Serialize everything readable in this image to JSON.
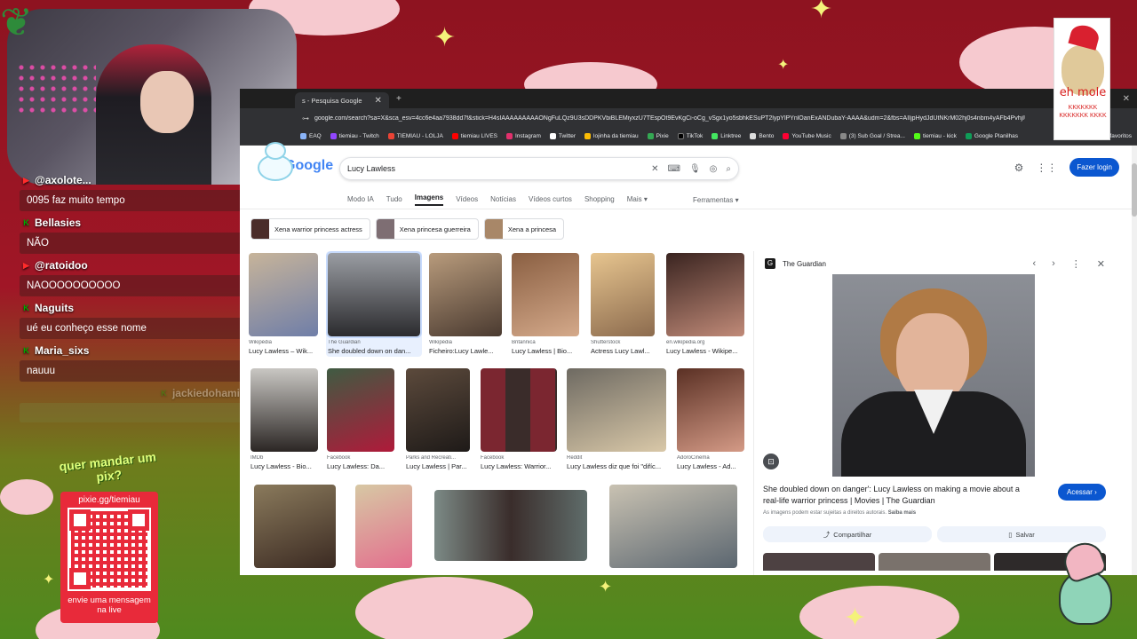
{
  "colors": {
    "bg_red": "#8e1320",
    "bg_green": "#4f8a1e",
    "accent_blue": "#0b57d0"
  },
  "stream": {
    "chat": [
      {
        "user": "@axolote...",
        "platform": "youtube",
        "message": "0095 faz muito tempo"
      },
      {
        "user": "Bellasies",
        "platform": "kick",
        "message": "NÃO"
      },
      {
        "user": "@ratoidoo",
        "platform": "youtube",
        "message": "NAOOOOOOOOOO"
      },
      {
        "user": "Naguits",
        "platform": "kick",
        "message": "ué eu conheço esse nome"
      },
      {
        "user": "Maria_sixs",
        "platform": "kick",
        "message": "nauuu"
      },
      {
        "user": "jackiedohamilton",
        "platform": "kick",
        "message": ""
      }
    ],
    "pix": {
      "title": "quer mandar um pix?",
      "url": "pixie.gg/tiemiau",
      "note": "envie uma mensagem na live"
    },
    "sticker": {
      "text1": "eh mole",
      "text2": "KKKKKKK KKKKKKK KKKK"
    }
  },
  "browser": {
    "tab_title": "s - Pesquisa Google",
    "url": "google.com/search?sa=X&sca_esv=4cc6e4aa7938dd7f&stick=H4sIAAAAAAAAAONgFuLQz9U3sDDPKVbiBLEMiyxzU7TEspOt9EvKgCi-oCg_vSgx1yo5sbhkESuPT2lypYlPYnlOanExANDubaY-AAAA&udm=2&fbs=AIIjpHydJdUtNKrM02hj0s4nbm4yAFb4PvhjIU",
    "bookmarks": [
      "EAQ",
      "tiemiau - Twitch",
      "TIEMIAU - LOLJA",
      "tiemiau LIVES",
      "Instagram",
      "Twitter",
      "lojinha da tiemiau",
      "Pixie",
      "TikTok",
      "Linktree",
      "Bento",
      "YouTube Music",
      "(3) Sub Goal / Strea...",
      "tiemiau - kick",
      "Google Planilhas"
    ],
    "bookmarks_more": "favoritos",
    "logo": "Google",
    "search_value": "Lucy Lawless",
    "login_label": "Fazer login",
    "nav_tabs": [
      "Modo IA",
      "Tudo",
      "Imagens",
      "Vídeos",
      "Notícias",
      "Vídeos curtos",
      "Shopping",
      "Mais ▾"
    ],
    "active_tab": "Imagens",
    "tools_label": "Ferramentas ▾",
    "chips": [
      "Xena warrior princess actress",
      "Xena princesa guerreira",
      "Xena a princesa"
    ],
    "results": [
      {
        "source": "Wikipédia",
        "title": "Lucy Lawless – Wik..."
      },
      {
        "source": "The Guardian",
        "title": "She doubled down on dan..."
      },
      {
        "source": "Wikipédia",
        "title": "Ficheiro:Lucy Lawle..."
      },
      {
        "source": "Britannica",
        "title": "Lucy Lawless | Bio..."
      },
      {
        "source": "Shutterstock",
        "title": "Actress Lucy Lawl..."
      },
      {
        "source": "en.wikipedia.org",
        "title": "Lucy Lawless - Wikipe..."
      },
      {
        "source": "IMDb",
        "title": "Lucy Lawless - Bio..."
      },
      {
        "source": "Facebook",
        "title": "Lucy Lawless: Da..."
      },
      {
        "source": "Parks and Recreati...",
        "title": "Lucy Lawless | Par..."
      },
      {
        "source": "Facebook",
        "title": "Lucy Lawless: Warrior..."
      },
      {
        "source": "Reddit",
        "title": "Lucy Lawless diz que foi \"difíc..."
      },
      {
        "source": "AdoroCinema",
        "title": "Lucy Lawless - Ad..."
      }
    ],
    "side": {
      "source": "The Guardian",
      "title": "She doubled down on danger': Lucy Lawless on making a movie about a real-life warrior princess | Movies | The Guardian",
      "visit_label": "Acessar ›",
      "note": "As imagens podem estar sujeitas a direitos autorais.",
      "note_link": "Saiba mais",
      "share_label": "Compartilhar",
      "save_label": "Salvar"
    }
  }
}
